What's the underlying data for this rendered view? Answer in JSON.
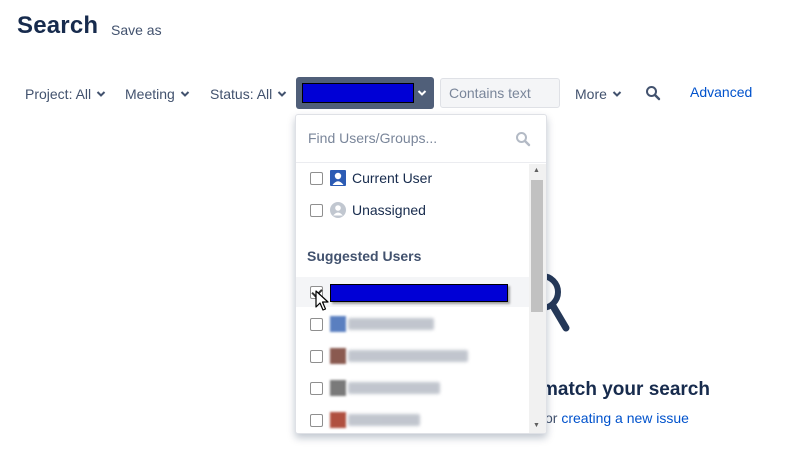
{
  "header": {
    "title": "Search",
    "save_as": "Save as"
  },
  "filters": {
    "project": "Project: All",
    "meeting": "Meeting",
    "status": "Status: All",
    "contains_text_placeholder": "Contains text",
    "more": "More",
    "advanced": "Advanced"
  },
  "dropdown": {
    "find_placeholder": "Find Users/Groups...",
    "options": [
      {
        "label": "Current User",
        "checked": false
      },
      {
        "label": "Unassigned",
        "checked": false
      }
    ],
    "section_heading": "Suggested Users",
    "suggested": [
      {
        "checked": true,
        "redacted": true
      },
      {
        "checked": false,
        "blurred": true
      },
      {
        "checked": false,
        "blurred": true
      },
      {
        "checked": false,
        "blurred": true
      },
      {
        "checked": false,
        "blurred": true
      }
    ]
  },
  "empty_state": {
    "heading": "match your search",
    "prefix": "or ",
    "link": "creating a new issue"
  },
  "colors": {
    "accent": "#0052cc",
    "redaction": "#0000d6",
    "user_filter_bg": "#505f79"
  }
}
